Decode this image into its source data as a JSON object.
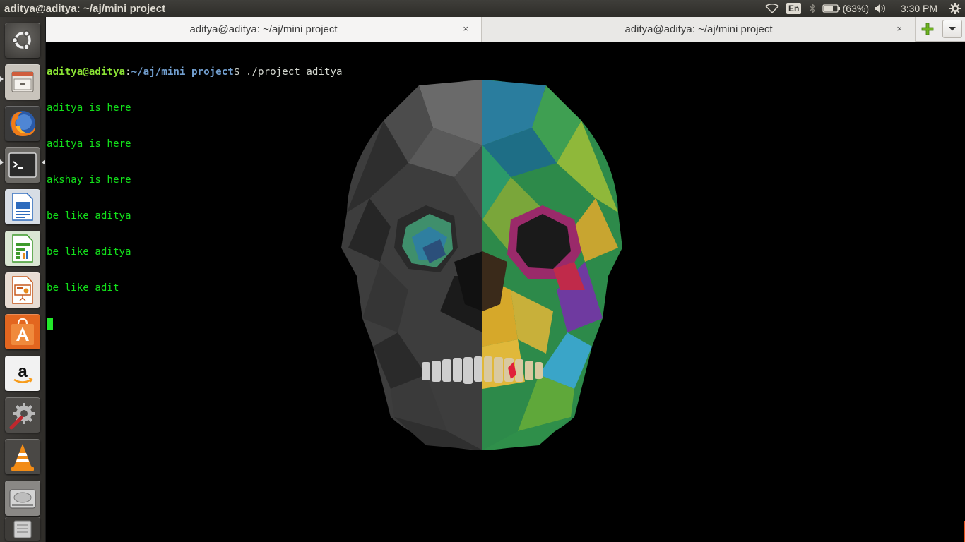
{
  "top_panel": {
    "window_title": "aditya@aditya: ~/aj/mini project",
    "keyboard_layout": "En",
    "battery_percent": "(63%)",
    "clock": "3:30 PM",
    "icons": [
      "wifi-icon",
      "bluetooth-icon",
      "battery-icon",
      "volume-icon",
      "gear-icon"
    ]
  },
  "launcher": {
    "items": [
      {
        "name": "dash-home",
        "icon": "ubuntu-logo-icon"
      },
      {
        "name": "files",
        "icon": "file-cabinet-icon"
      },
      {
        "name": "firefox",
        "icon": "firefox-icon"
      },
      {
        "name": "terminal",
        "icon": "terminal-icon",
        "active": true
      },
      {
        "name": "libreoffice-writer",
        "icon": "writer-icon"
      },
      {
        "name": "libreoffice-calc",
        "icon": "calc-icon"
      },
      {
        "name": "libreoffice-impress",
        "icon": "impress-icon"
      },
      {
        "name": "ubuntu-software-center",
        "icon": "software-center-icon"
      },
      {
        "name": "amazon",
        "icon": "amazon-icon"
      },
      {
        "name": "system-settings",
        "icon": "settings-icon"
      },
      {
        "name": "vlc",
        "icon": "vlc-icon"
      },
      {
        "name": "disk",
        "icon": "disk-icon"
      },
      {
        "name": "trash",
        "icon": "trash-icon"
      }
    ]
  },
  "tabs": [
    {
      "title": "aditya@aditya: ~/aj/mini project",
      "close": "×",
      "active": true
    },
    {
      "title": "aditya@aditya: ~/aj/mini project",
      "close": "×",
      "active": false
    }
  ],
  "terminal": {
    "prompt_user": "aditya@aditya",
    "prompt_sep": ":",
    "prompt_path": "~/aj/mini project",
    "prompt_symbol": "$ ",
    "command": "./project aditya",
    "output": [
      "aditya is here",
      "aditya is here",
      "akshay is here",
      "be like aditya",
      "be like aditya",
      "be like adit"
    ]
  },
  "colors": {
    "prompt_user": "#8ae234",
    "prompt_path": "#729fcf",
    "output_text": "#13e01b",
    "terminal_bg": "#000000",
    "accent": "#e95420"
  }
}
